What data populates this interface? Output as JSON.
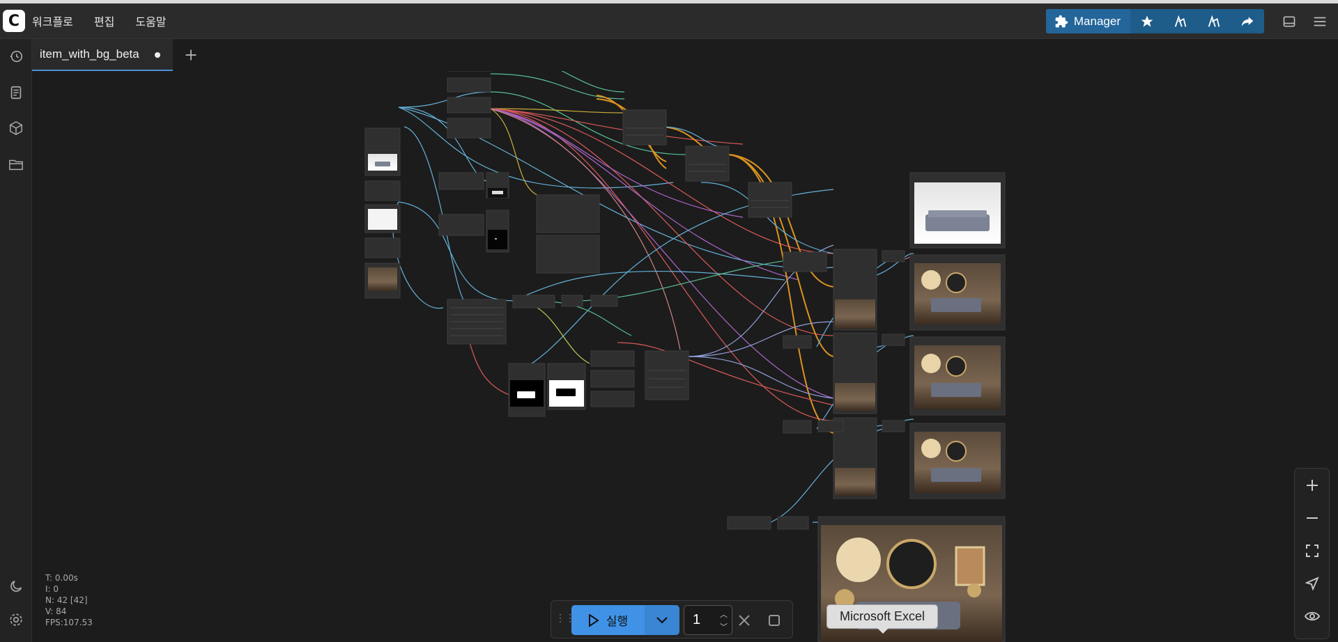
{
  "app": {
    "menu": [
      "워크플로",
      "편집",
      "도움말"
    ],
    "manager_label": "Manager",
    "logo_letter": "C"
  },
  "tab": {
    "label": "item_with_bg_beta"
  },
  "stats": {
    "t": "T: 0.00s",
    "i": "I: 0",
    "n": "N: 42 [42]",
    "v": "V: 84",
    "fps": "FPS:107.53"
  },
  "run": {
    "label": "실행",
    "count": "1"
  },
  "tooltip": "Microsoft Excel",
  "colors": {
    "accent": "#3f92e6",
    "manager": "#24669a",
    "canvas_bg": "#1c1c1c"
  },
  "icons": {
    "left_sidebar": [
      "history-icon",
      "document-icon",
      "cube-icon",
      "folder-icon",
      "moon-icon",
      "settings-icon"
    ],
    "toolbar": [
      "puzzle-icon",
      "star-icon",
      "dashboard-icon",
      "dashboard-alt-icon",
      "share-icon",
      "panel-icon",
      "hamburger-menu-icon"
    ],
    "zoom": [
      "zoom-in-icon",
      "zoom-out-icon",
      "fit-view-icon",
      "locate-icon",
      "eye-icon"
    ]
  }
}
